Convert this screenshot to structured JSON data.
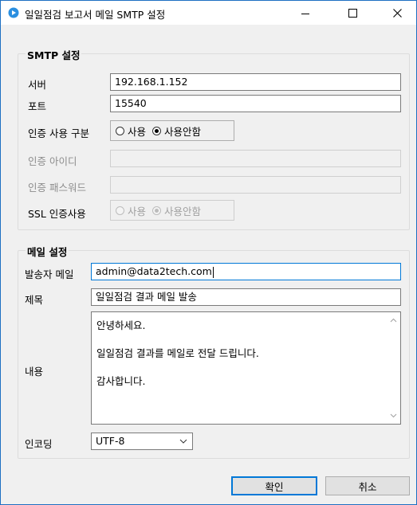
{
  "window": {
    "title": "일일점검 보고서 메일 SMTP 설정",
    "accent_color": "#0078d7",
    "controls": {
      "minimize_icon": "minimize-icon",
      "maximize_icon": "maximize-icon",
      "close_icon": "close-icon",
      "close_label": "✕"
    }
  },
  "smtp": {
    "group_title": "SMTP 설정",
    "server_label": "서버",
    "server_value": "192.168.1.152",
    "port_label": "포트",
    "port_value": "15540",
    "auth_label": "인증 사용 구분",
    "auth_options": [
      "사용",
      "사용안함"
    ],
    "auth_selected": "사용안함",
    "auth_id_label": "인증 아이디",
    "auth_id_value": "",
    "auth_pw_label": "인증 패스워드",
    "auth_pw_value": "",
    "ssl_label": "SSL 인증사용",
    "ssl_options": [
      "사용",
      "사용안함"
    ],
    "ssl_selected": "사용안함"
  },
  "mail": {
    "group_title": "메일 설정",
    "sender_label": "발송자 메일",
    "sender_value": "admin@data2tech.com",
    "subject_label": "제목",
    "subject_value": "일일점검 결과 메일 발송",
    "body_label": "내용",
    "body_lines": [
      "안녕하세요.",
      "일일점검 결과를 메일로 전달 드립니다.",
      "감사합니다."
    ],
    "encoding_label": "인코딩",
    "encoding_value": "UTF-8"
  },
  "buttons": {
    "ok": "확인",
    "cancel": "취소"
  }
}
